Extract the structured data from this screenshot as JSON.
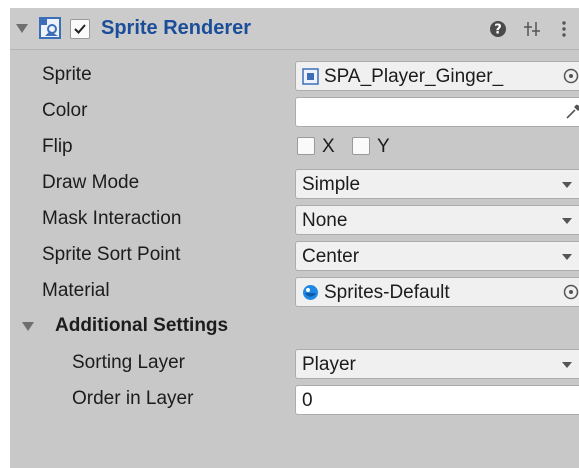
{
  "component": {
    "title": "Sprite Renderer",
    "enabled": true
  },
  "fields": {
    "sprite": {
      "label": "Sprite",
      "value": "SPA_Player_Ginger_"
    },
    "color": {
      "label": "Color",
      "value": "#FFFFFF"
    },
    "flip": {
      "label": "Flip",
      "x_label": "X",
      "y_label": "Y",
      "x_checked": false,
      "y_checked": false
    },
    "draw_mode": {
      "label": "Draw Mode",
      "value": "Simple"
    },
    "mask_interaction": {
      "label": "Mask Interaction",
      "value": "None"
    },
    "sprite_sort_point": {
      "label": "Sprite Sort Point",
      "value": "Center"
    },
    "material": {
      "label": "Material",
      "value": "Sprites-Default"
    }
  },
  "additional_settings": {
    "title": "Additional Settings",
    "sorting_layer": {
      "label": "Sorting Layer",
      "value": "Player"
    },
    "order_in_layer": {
      "label": "Order in Layer",
      "value": "0"
    }
  },
  "colors": {
    "title": "#1b4e9a",
    "panel_bg": "#c8c8c8",
    "material_icon": "#1e88e5"
  },
  "icons": [
    "component-icon",
    "checkbox-icon",
    "help-icon",
    "preset-icon",
    "more-icon",
    "sprite-object-icon",
    "object-picker-icon",
    "eyedropper-icon",
    "material-icon",
    "dropdown-arrow-icon",
    "fold-arrow-icon"
  ]
}
